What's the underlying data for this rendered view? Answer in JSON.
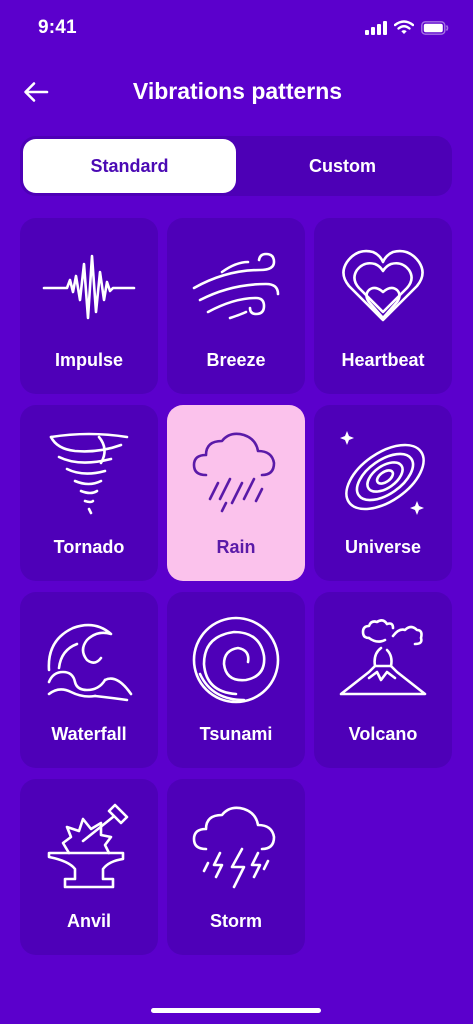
{
  "status_bar": {
    "time": "9:41",
    "icons": [
      "signal-icon",
      "wifi-icon",
      "battery-icon"
    ]
  },
  "header": {
    "back_icon": "arrow-left-icon",
    "title": "Vibrations patterns"
  },
  "tabs": [
    {
      "label": "Standard",
      "active": true
    },
    {
      "label": "Custom",
      "active": false
    }
  ],
  "patterns": [
    {
      "label": "Impulse",
      "icon": "impulse-icon"
    },
    {
      "label": "Breeze",
      "icon": "breeze-icon"
    },
    {
      "label": "Heartbeat",
      "icon": "heartbeat-icon"
    },
    {
      "label": "Tornado",
      "icon": "tornado-icon"
    },
    {
      "label": "Rain",
      "icon": "rain-icon",
      "selected": true
    },
    {
      "label": "Universe",
      "icon": "universe-icon"
    },
    {
      "label": "Waterfall",
      "icon": "waterfall-icon"
    },
    {
      "label": "Tsunami",
      "icon": "tsunami-icon"
    },
    {
      "label": "Volcano",
      "icon": "volcano-icon"
    },
    {
      "label": "Anvil",
      "icon": "anvil-icon"
    },
    {
      "label": "Storm",
      "icon": "storm-icon"
    }
  ],
  "colors": {
    "background": "#5b00cc",
    "tile": "#4e00b8",
    "selected_tile": "#fbc2ec",
    "selected_text": "#5a1aa8",
    "active_tab_bg": "#ffffff",
    "active_tab_text": "#4b0ab4"
  }
}
